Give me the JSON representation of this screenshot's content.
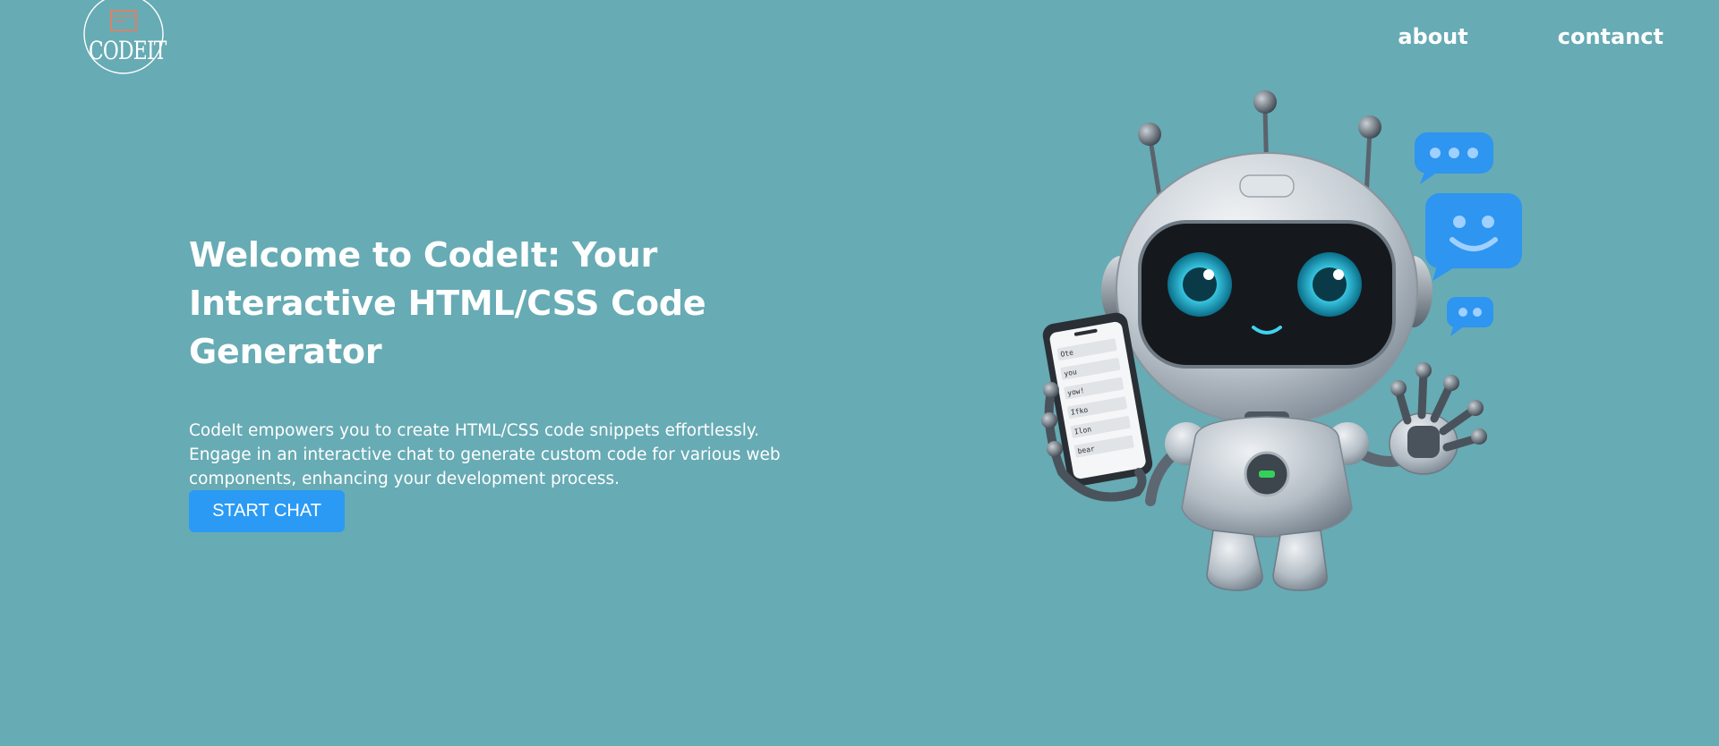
{
  "brand": {
    "logo_text": "CODEIT"
  },
  "nav": {
    "items": [
      {
        "label": "about"
      },
      {
        "label": "contanct"
      }
    ]
  },
  "hero": {
    "title": "Welcome to CodeIt: Your Interactive HTML/CSS Code Generator",
    "description": "CodeIt empowers you to create HTML/CSS code snippets effortlessly. Engage in an interactive chat to generate custom code for various web components, enhancing your development process.",
    "cta_label": "START CHAT"
  },
  "phone_screen": {
    "lines": [
      "Ote",
      "you",
      "yow!",
      "Ifko",
      "Ilon",
      "bear"
    ]
  },
  "colors": {
    "background": "#67abb4",
    "accent": "#2a9af5",
    "bubble": "#2e95f0"
  }
}
